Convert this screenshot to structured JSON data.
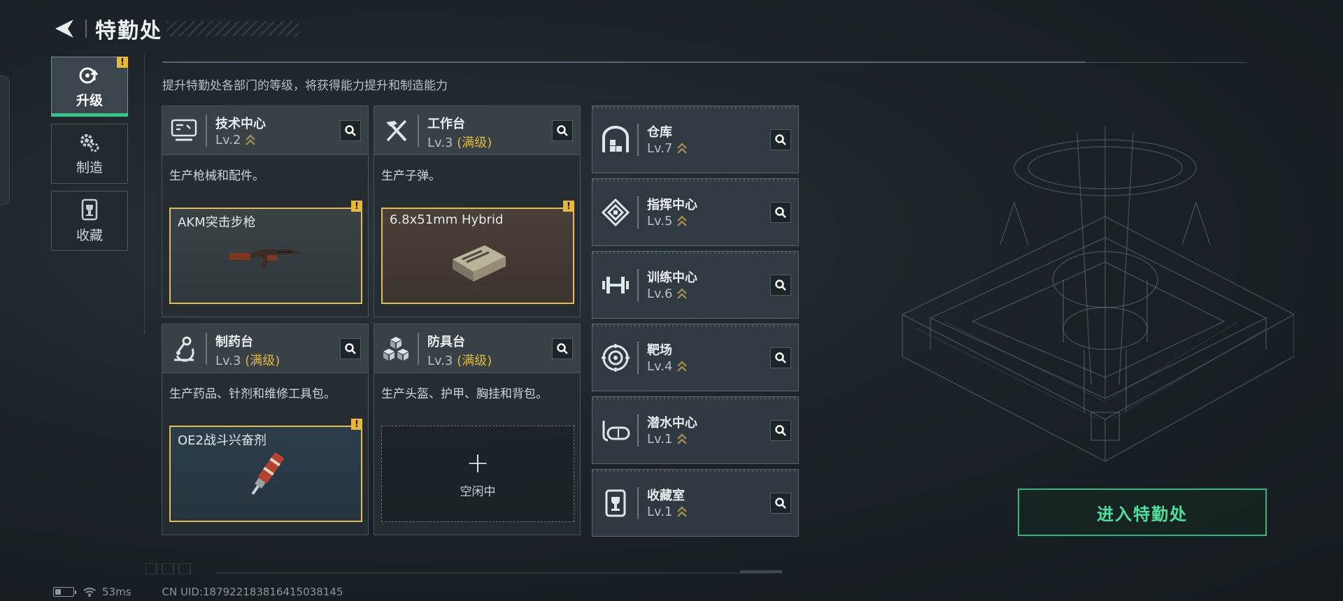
{
  "header": {
    "title": "特勤处"
  },
  "nav": {
    "items": [
      {
        "label": "升级",
        "icon": "upgrade-icon",
        "active": true,
        "alert": "!"
      },
      {
        "label": "制造",
        "icon": "gears-icon",
        "active": false
      },
      {
        "label": "收藏",
        "icon": "trophy-case-icon",
        "active": false
      }
    ]
  },
  "hint": "提升特勤处各部门的等级，将获得能力提升和制造能力",
  "departments": [
    {
      "name": "技术中心",
      "level": "Lv.2",
      "maxed": "",
      "icon": "computer-icon",
      "desc": "生产枪械和配件。",
      "slot": {
        "label": "AKM突击步枪",
        "alert": "!",
        "item_icon": "rifle-icon"
      }
    },
    {
      "name": "工作台",
      "level": "Lv.3",
      "maxed": "(满级)",
      "icon": "tools-icon",
      "desc": "生产子弹。",
      "slot": {
        "label": "6.8x51mm Hybrid",
        "alert": "!",
        "item_icon": "ammo-box-icon"
      }
    },
    {
      "name": "制药台",
      "level": "Lv.3",
      "maxed": "(满级)",
      "icon": "microscope-icon",
      "desc": "生产药品、针剂和维修工具包。",
      "slot": {
        "label": "OE2战斗兴奋剂",
        "alert": "!",
        "item_icon": "injector-icon"
      }
    },
    {
      "name": "防具台",
      "level": "Lv.3",
      "maxed": "(满级)",
      "icon": "armor-blocks-icon",
      "desc": "生产头盔、护甲、胸挂和背包。",
      "slot": {
        "empty_plus": "+",
        "empty_label": "空闲中"
      }
    }
  ],
  "facilities": [
    {
      "name": "仓库",
      "level": "Lv.7",
      "icon": "warehouse-icon"
    },
    {
      "name": "指挥中心",
      "level": "Lv.5",
      "icon": "command-icon"
    },
    {
      "name": "训练中心",
      "level": "Lv.6",
      "icon": "dumbbell-icon"
    },
    {
      "name": "靶场",
      "level": "Lv.4",
      "icon": "target-icon"
    },
    {
      "name": "潜水中心",
      "level": "Lv.1",
      "icon": "diving-mask-icon"
    },
    {
      "name": "收藏室",
      "level": "Lv.1",
      "icon": "trophy-case-icon"
    }
  ],
  "enter_button": "进入特勤处",
  "status": {
    "ping": "53ms",
    "uid": "CN UID:1879221838164150381​45"
  },
  "colors": {
    "accent_green": "#37c48a",
    "warning_yellow": "#e8b83a",
    "slot_border": "#e1bd52"
  }
}
